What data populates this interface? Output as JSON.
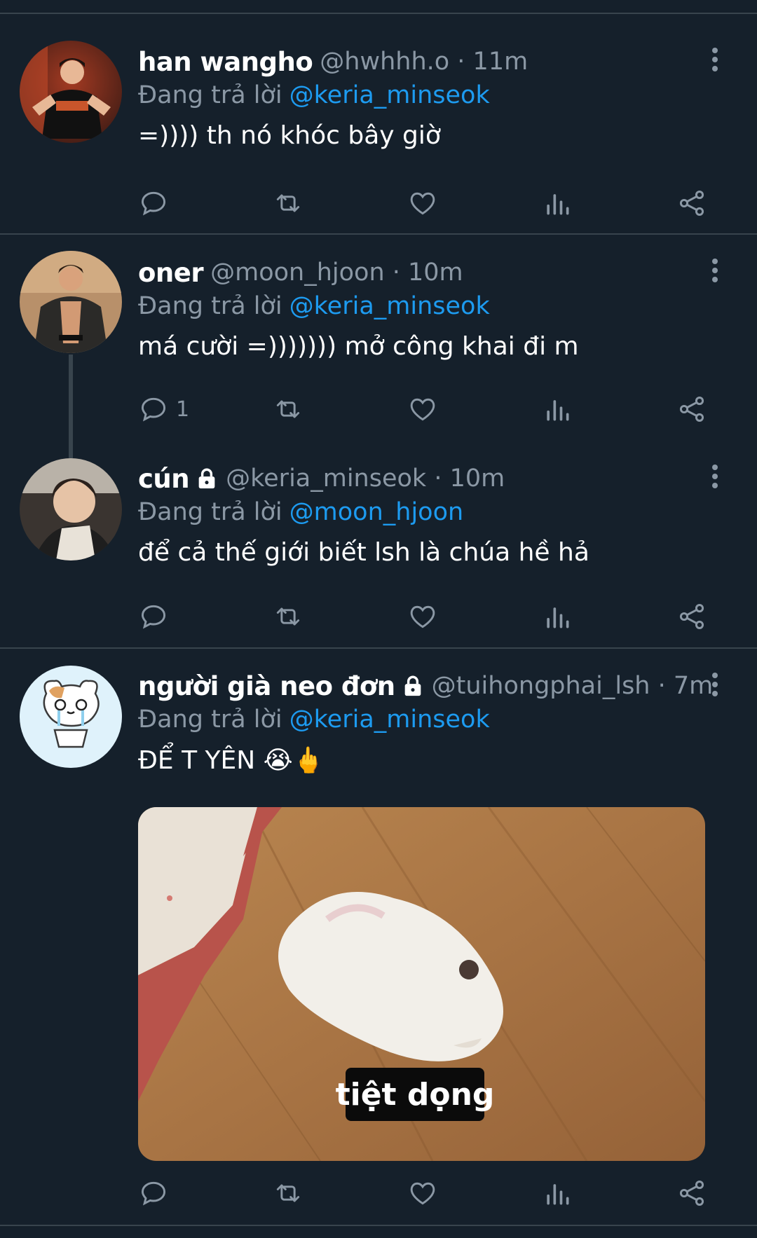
{
  "tweets": [
    {
      "name": "han wangho",
      "handle": "@hwhhh.o · 11m",
      "reply_prefix": "Đang trả lời",
      "reply_to": "@keria_minseok",
      "text": "=)))) th nó khóc bây giờ",
      "reply_count": ""
    },
    {
      "name": "oner",
      "handle": "@moon_hjoon · 10m",
      "reply_prefix": "Đang trả lời",
      "reply_to": "@keria_minseok",
      "text": "má cười =))))))) mở công khai đi m",
      "reply_count": "1"
    },
    {
      "name": "cún",
      "handle": "@keria_minseok · 10m",
      "reply_prefix": "Đang trả lời",
      "reply_to": "@moon_hjoon",
      "text": "để cả thế giới biết lsh là chúa hề hả",
      "reply_count": ""
    },
    {
      "name": "người già neo đơn",
      "handle": "@tuihongphai_lsh · 7m",
      "reply_prefix": "Đang trả lời",
      "reply_to": "@keria_minseok",
      "text": "ĐỂ T YÊN",
      "emoji_text": "😭🖕",
      "reply_count": "",
      "media_caption": "tiệt dọng"
    }
  ],
  "icons": {
    "reply": "reply-icon",
    "retweet": "retweet-icon",
    "like": "heart-icon",
    "views": "views-icon",
    "share": "share-icon",
    "more": "more-options-icon",
    "lock": "lock-icon"
  },
  "colors": {
    "background": "#15202b",
    "accent": "#1d9bf0",
    "secondary_text": "#8b98a5",
    "divider": "#38444d"
  }
}
